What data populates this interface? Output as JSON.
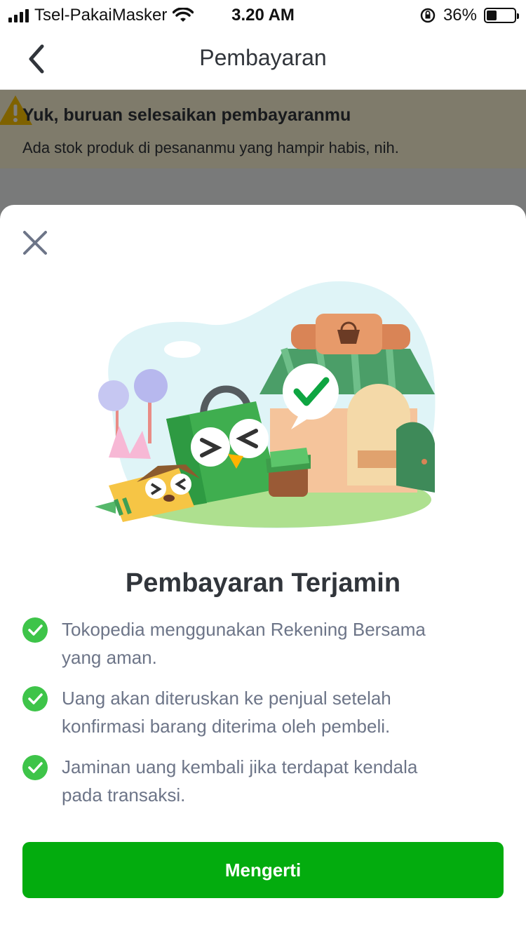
{
  "status_bar": {
    "carrier": "Tsel-PakaiMasker",
    "time": "3.20 AM",
    "battery": "36%",
    "battery_level": 0.36
  },
  "header": {
    "title": "Pembayaran",
    "back_icon": "chevron-left-icon"
  },
  "background": {
    "warning_title": "Yuk, buruan selesaikan pembayaranmu",
    "warning_text": "Ada stok produk di pesananmu yang hampir habis, nih.",
    "warning_icon": "warning-triangle-icon",
    "banner_color": "#fff6d6"
  },
  "modal": {
    "close_icon": "close-icon",
    "illustration": "tokopedia-store-mascot-illustration",
    "title": "Pembayaran Terjamin",
    "features": [
      {
        "line1": "Tokopedia menggunakan Rekening Bersama",
        "line2": "yang aman."
      },
      {
        "line1": "Uang akan diteruskan ke penjual setelah",
        "line2": "konfirmasi barang diterima oleh pembeli."
      },
      {
        "line1": "Jaminan uang kembali jika terdapat kendala",
        "line2": "pada transaksi."
      }
    ],
    "button_label": "Mengerti"
  },
  "colors": {
    "accent": "#03ac0e",
    "check": "#3ec449",
    "text_primary": "#31353b",
    "text_secondary": "#6d7588"
  }
}
